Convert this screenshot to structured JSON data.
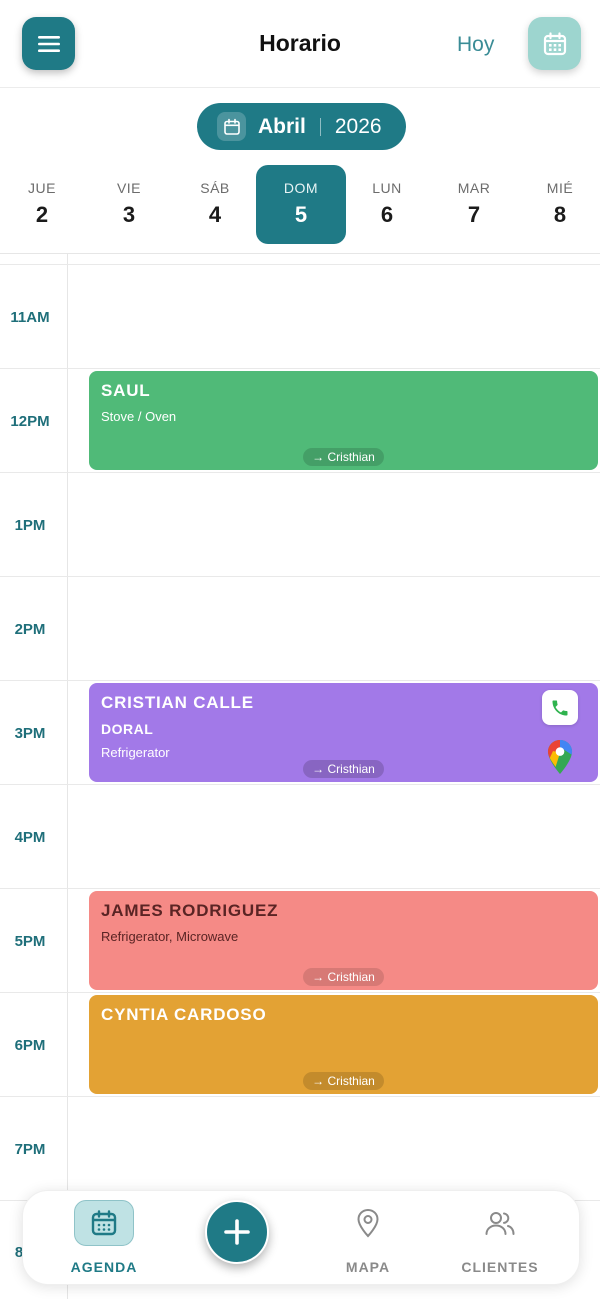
{
  "header": {
    "title": "Horario",
    "today_label": "Hoy",
    "menu_icon": "menu-icon",
    "calendar_icon": "calendar-icon"
  },
  "month_selector": {
    "month": "Abril",
    "year": "2026",
    "icon": "calendar-icon"
  },
  "days": [
    {
      "name": "JUE",
      "num": "2",
      "selected": false
    },
    {
      "name": "VIE",
      "num": "3",
      "selected": false
    },
    {
      "name": "SÁB",
      "num": "4",
      "selected": false
    },
    {
      "name": "DOM",
      "num": "5",
      "selected": true
    },
    {
      "name": "LUN",
      "num": "6",
      "selected": false
    },
    {
      "name": "MAR",
      "num": "7",
      "selected": false
    },
    {
      "name": "MIÉ",
      "num": "8",
      "selected": false
    }
  ],
  "hours": [
    "11AM",
    "12PM",
    "1PM",
    "2PM",
    "3PM",
    "4PM",
    "5PM",
    "6PM",
    "7PM",
    "8"
  ],
  "appointments": [
    {
      "name": "SAUL",
      "location": "",
      "service": "Stove / Oven",
      "technician": "→ Cristhian",
      "color": "#50ba78"
    },
    {
      "name": "CRISTIAN CALLE",
      "location": "DORAL",
      "service": "Refrigerator",
      "technician": "→ Cristhian",
      "color": "#a279e8",
      "actions": [
        "phone-icon",
        "google-maps-icon"
      ]
    },
    {
      "name": "JAMES RODRIGUEZ",
      "location": "",
      "service": "Refrigerator, Microwave",
      "technician": "→ Cristhian",
      "color": "#f58a86"
    },
    {
      "name": "CYNTIA CARDOSO",
      "location": "",
      "service": "",
      "technician": "→ Cristhian",
      "color": "#e3a234"
    }
  ],
  "bottom_nav": {
    "items": [
      {
        "label": "AGENDA",
        "icon": "calendar-icon",
        "active": true
      },
      {
        "label": "",
        "icon": "plus-icon",
        "active": false
      },
      {
        "label": "MAPA",
        "icon": "map-pin-icon",
        "active": false
      },
      {
        "label": "CLIENTES",
        "icon": "users-icon",
        "active": false
      }
    ]
  },
  "colors": {
    "accent": "#1f7a86",
    "accent_light": "#9dd5cf"
  }
}
